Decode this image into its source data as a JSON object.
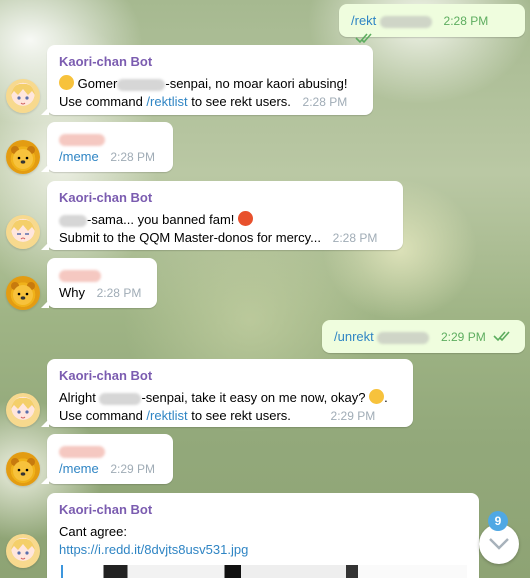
{
  "messages": [
    {
      "id": "m1",
      "direction": "out",
      "text": "/rekt",
      "time": "2:28 PM"
    },
    {
      "id": "m2",
      "direction": "in",
      "sender": "Kaori-chan Bot",
      "line1_prefix": "Gomer",
      "line1_suffix": "-senpai, no moar kaori abusing!",
      "line2_prefix": "Use command ",
      "line2_link": "/rektlist",
      "line2_suffix": " to see rekt users.",
      "time": "2:28 PM"
    },
    {
      "id": "m3",
      "direction": "in",
      "text": "/meme",
      "time": "2:28 PM"
    },
    {
      "id": "m4",
      "direction": "in",
      "sender": "Kaori-chan Bot",
      "line1_suffix": "-sama... you banned fam! ",
      "line2": "Submit to the QQM Master-donos for mercy...",
      "time": "2:28 PM"
    },
    {
      "id": "m5",
      "direction": "in",
      "text": "Why",
      "time": "2:28 PM"
    },
    {
      "id": "m6",
      "direction": "out",
      "text": "/unrekt",
      "time": "2:29 PM"
    },
    {
      "id": "m7",
      "direction": "in",
      "sender": "Kaori-chan Bot",
      "line1_prefix": "Alright ",
      "line1_suffix": "-senpai, take it easy on me now, okay? ",
      "line2_prefix": "Use command ",
      "line2_link": "/rektlist",
      "line2_suffix": " to see rekt users.",
      "time": "2:29 PM"
    },
    {
      "id": "m8",
      "direction": "in",
      "text": "/meme",
      "time": "2:29 PM"
    },
    {
      "id": "m9",
      "direction": "in",
      "sender": "Kaori-chan Bot",
      "line1": "Cant agree:",
      "link": "https://i.redd.it/8dvjts8usv531.jpg"
    }
  ],
  "scroll_button": {
    "unread_count": "9"
  },
  "colors": {
    "outgoing_bubble": "#effdde",
    "incoming_bubble": "#ffffff",
    "sender_name": "#7b5cb0",
    "link": "#2f85c4",
    "badge": "#4fa8e4"
  }
}
